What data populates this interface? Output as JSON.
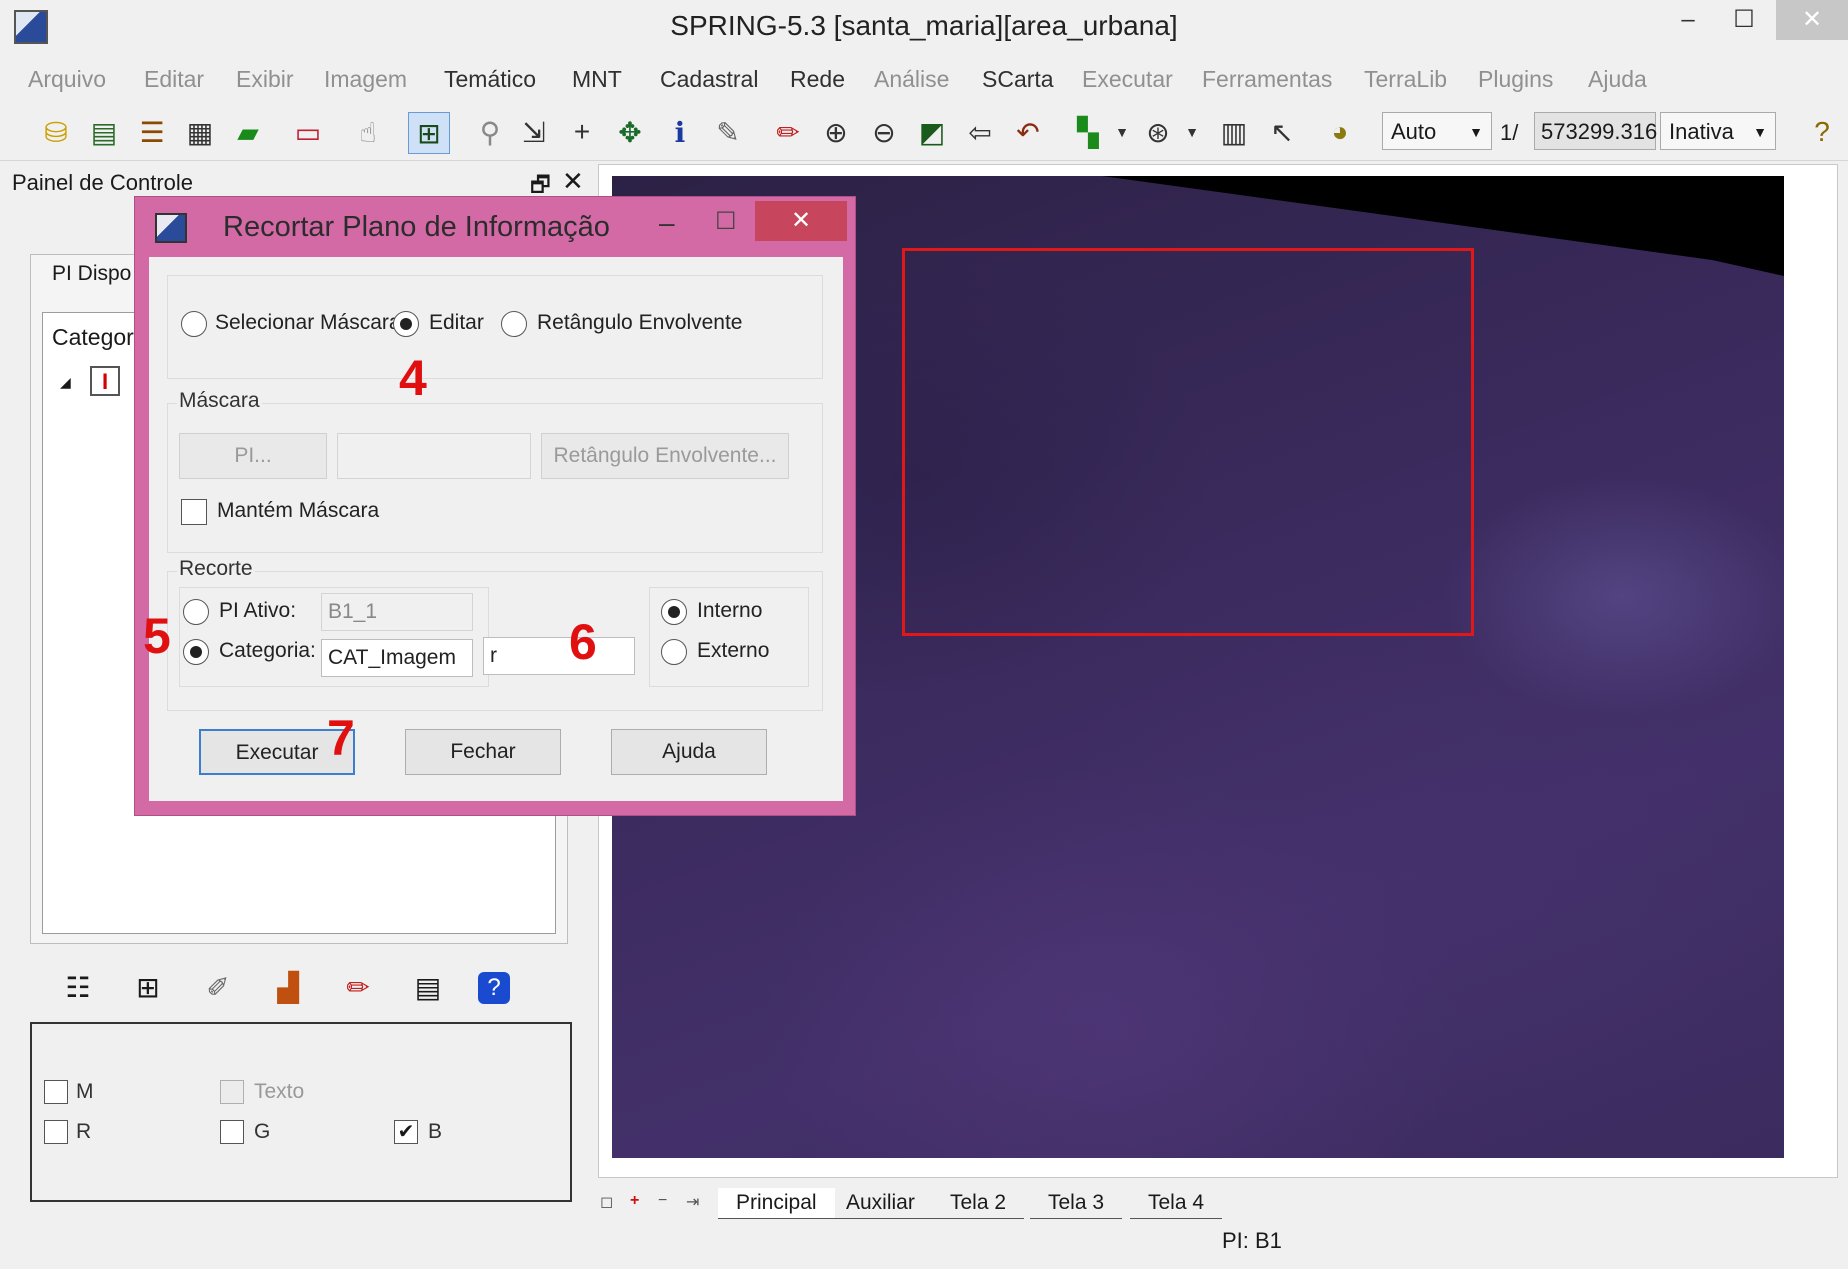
{
  "window": {
    "title": "SPRING-5.3 [santa_maria][area_urbana]",
    "min_glyph": "–",
    "max_glyph": "☐",
    "close_glyph": "✕"
  },
  "menu": [
    {
      "label": "Arquivo",
      "enabled": false
    },
    {
      "label": "Editar",
      "enabled": false
    },
    {
      "label": "Exibir",
      "enabled": false
    },
    {
      "label": "Imagem",
      "enabled": false
    },
    {
      "label": "Temático",
      "enabled": true
    },
    {
      "label": "MNT",
      "enabled": true
    },
    {
      "label": "Cadastral",
      "enabled": true
    },
    {
      "label": "Rede",
      "enabled": true
    },
    {
      "label": "Análise",
      "enabled": false
    },
    {
      "label": "SCarta",
      "enabled": true
    },
    {
      "label": "Executar",
      "enabled": false
    },
    {
      "label": "Ferramentas",
      "enabled": false
    },
    {
      "label": "TerraLib",
      "enabled": false
    },
    {
      "label": "Plugins",
      "enabled": false
    },
    {
      "label": "Ajuda",
      "enabled": false
    }
  ],
  "toolbar": {
    "zoom_mode": "Auto",
    "scale_prefix": "1/",
    "scale_value": "573299.316",
    "mode": "Inativa"
  },
  "panel": {
    "title": "Painel de Controle",
    "tab_label": "PI Dispo",
    "tree_header": "Categor",
    "category_icon_glyph": "I",
    "float_glyph": "🗗",
    "close_glyph": "✕"
  },
  "rgb": {
    "m_label": "M",
    "texto_label": "Texto",
    "r_label": "R",
    "g_label": "G",
    "b_label": "B",
    "m_checked": false,
    "texto_checked": false,
    "r_checked": false,
    "g_checked": false,
    "b_checked": true,
    "check_glyph": "✔"
  },
  "tabs": [
    "Principal",
    "Auxiliar",
    "Tela 2",
    "Tela 3",
    "Tela 4"
  ],
  "tab_active": "Principal",
  "status": {
    "pi": "PI: B1"
  },
  "dialog": {
    "title": "Recortar Plano de Informação",
    "mode_options": [
      "Selecionar Máscara",
      "Editar",
      "Retângulo Envolvente"
    ],
    "mode_selected": "Editar",
    "mascara": {
      "title": "Máscara",
      "pi_button": "PI...",
      "pi_value": "",
      "rect_button": "Retângulo Envolvente...",
      "keep_label": "Mantém Máscara",
      "keep_checked": false
    },
    "recorte": {
      "title": "Recorte",
      "pi_ativo_label": "PI Ativo:",
      "pi_ativo_value": "B1_1",
      "categoria_label": "Categoria:",
      "categoria_value": "CAT_Imagem",
      "name_value": "r",
      "source_selected": "Categoria",
      "interno_label": "Interno",
      "externo_label": "Externo",
      "side_selected": "Interno"
    },
    "buttons": {
      "execute": "Executar",
      "close": "Fechar",
      "help": "Ajuda"
    }
  },
  "annotations": [
    "4",
    "5",
    "6",
    "7"
  ],
  "colors": {
    "accent_dialog": "#d36aa6",
    "roi": "#e01818",
    "annotation": "#e01010"
  }
}
